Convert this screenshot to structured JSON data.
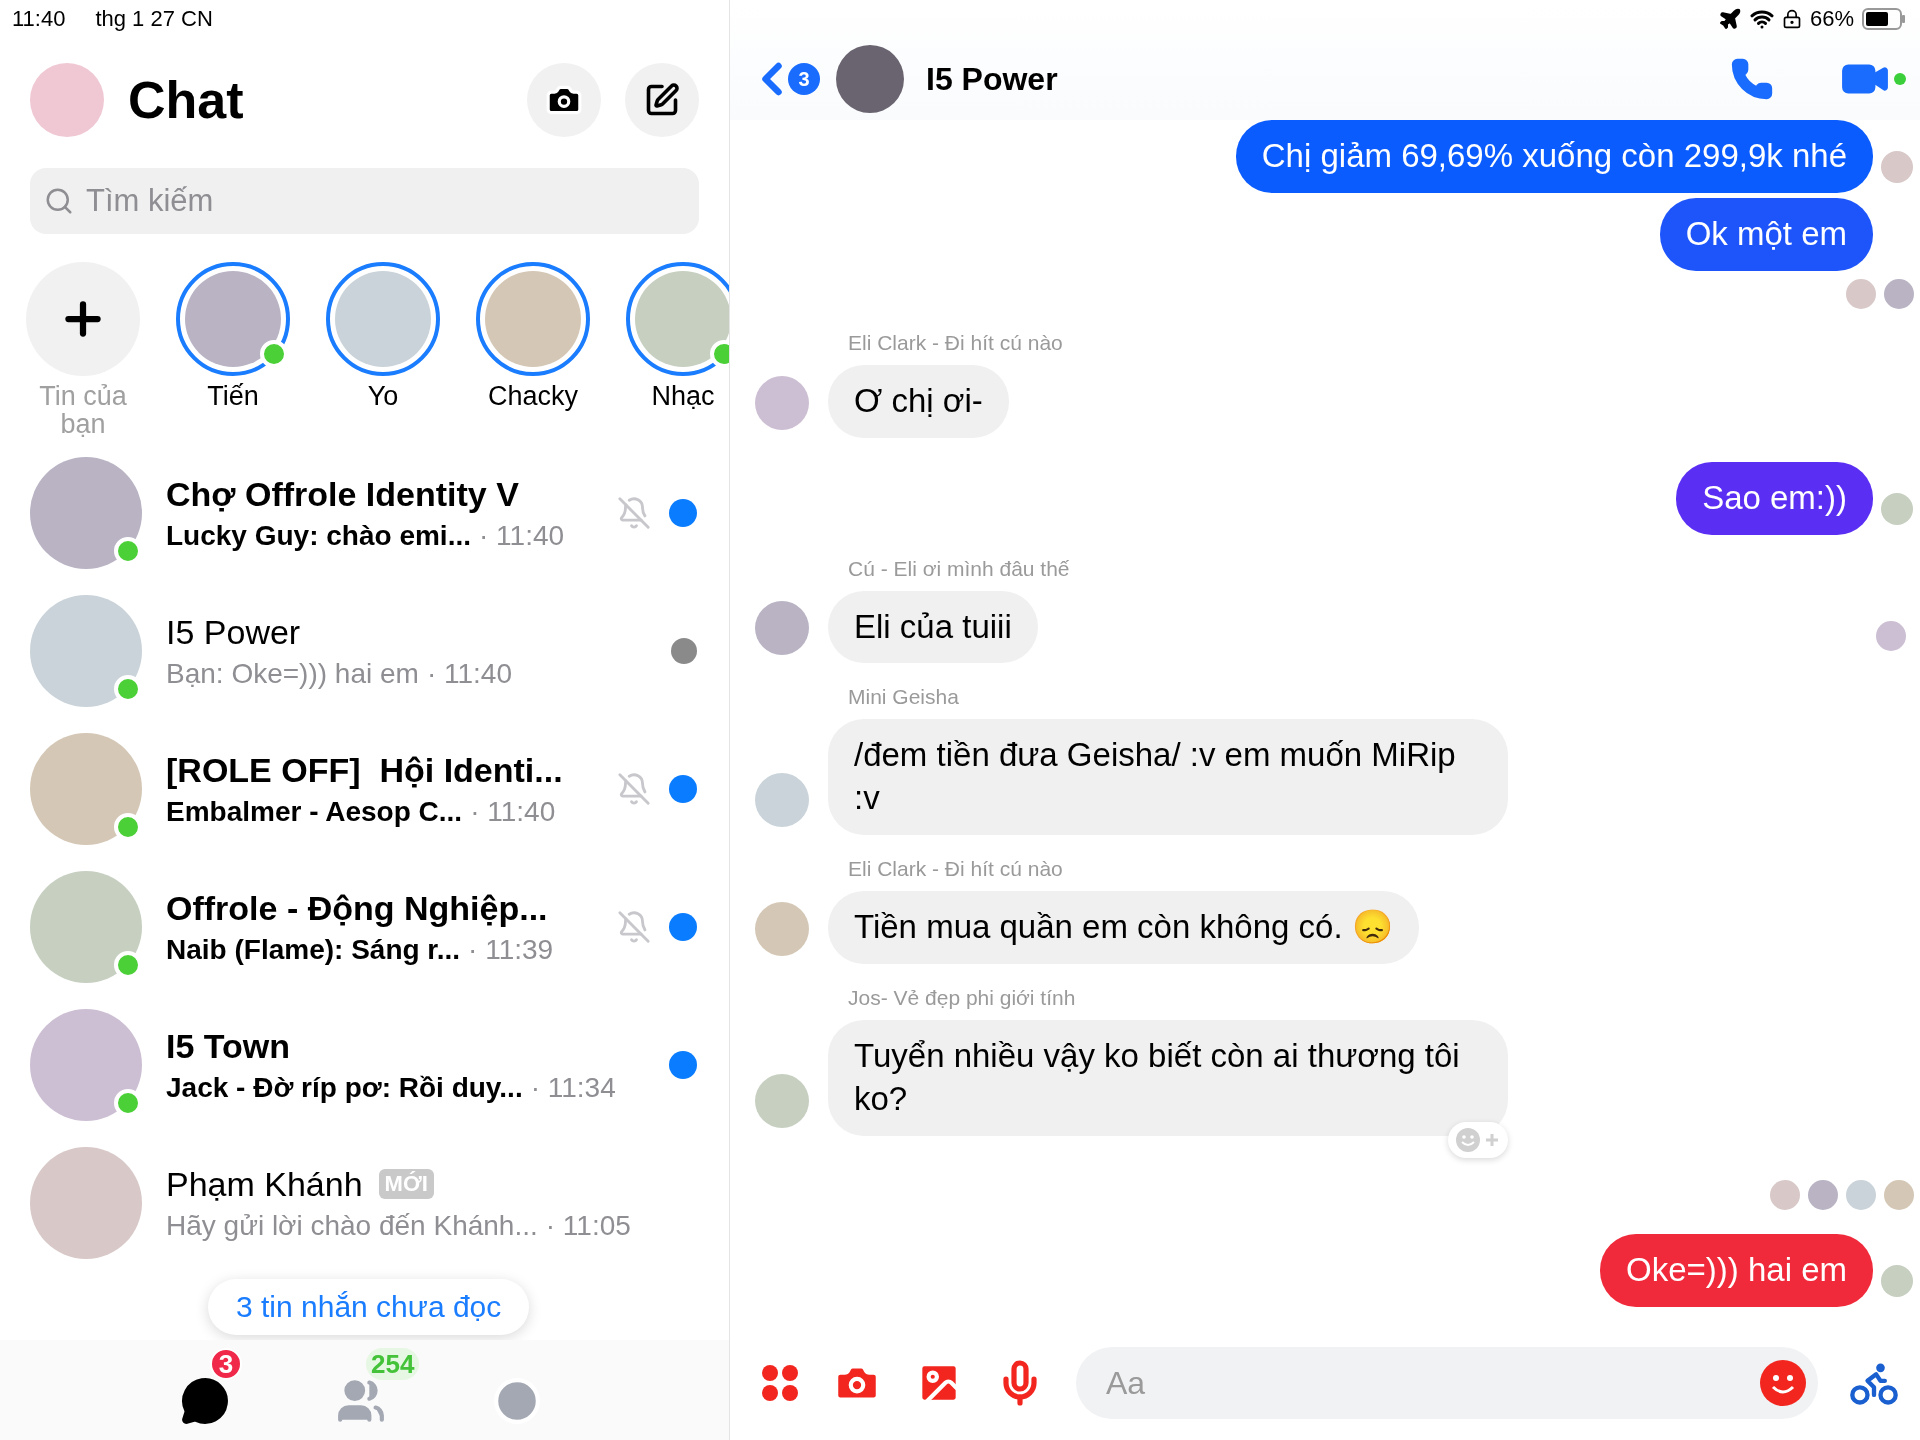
{
  "status_bar": {
    "time": "11:40",
    "date": "thg 1 27 CN",
    "battery_text": "66%"
  },
  "sidebar": {
    "title": "Chat",
    "search": {
      "placeholder": "Tìm kiếm"
    },
    "stories": [
      {
        "kind": "add",
        "label": "Tin của bạn",
        "online": false
      },
      {
        "kind": "story",
        "label": "Tiến",
        "online": true
      },
      {
        "kind": "story",
        "label": "Yo",
        "online": false
      },
      {
        "kind": "story",
        "label": "Chacky",
        "online": false
      },
      {
        "kind": "story",
        "label": "Nhạc",
        "online": true
      }
    ],
    "chats": [
      {
        "name": "Chợ Offrole Identity V",
        "preview": "Lucky Guy: chào emi...",
        "time": "· 11:40",
        "unread": true,
        "muted": true,
        "online": true,
        "seen": false
      },
      {
        "name": "I5 Power",
        "preview": "Bạn: Oke=))) hai em",
        "time": "· 11:40",
        "unread": false,
        "muted": false,
        "online": true,
        "seen": true
      },
      {
        "name": "[ROLE OFF]  Hội Identi...",
        "preview": "Embalmer - Aesop C...",
        "time": "· 11:40",
        "unread": true,
        "muted": true,
        "online": true,
        "seen": false
      },
      {
        "name": "Offrole - Động Nghiệp...",
        "preview": "Naib (Flame): Sáng r...",
        "time": "· 11:39",
        "unread": true,
        "muted": true,
        "online": true,
        "seen": false
      },
      {
        "name": "I5 Town",
        "preview": "Jack - Đờ ríp pơ: Rồi duy...",
        "time": "· 11:34",
        "unread": true,
        "muted": false,
        "online": true,
        "seen": false
      },
      {
        "name": "Phạm Khánh",
        "badge": "MỚI",
        "preview": "Hãy gửi lời chào đến Khánh...",
        "time": "· 11:05",
        "unread": false,
        "muted": false,
        "online": false,
        "seen": false
      }
    ],
    "unread_pill": "3 tin nhắn chưa đọc",
    "tabs": [
      {
        "kind": "chats",
        "badge": "3",
        "selected": true
      },
      {
        "kind": "people",
        "badge": "254",
        "selected": false
      },
      {
        "kind": "discover",
        "selected": false
      }
    ]
  },
  "conversation": {
    "back_badge": "3",
    "title": "I5 Power",
    "active": true,
    "messages": [
      {
        "kind": "outgoing",
        "text": "Chị giảm 69,69% xuống còn 299,9k nhé",
        "color": "#0b5cff",
        "read_avatar": true
      },
      {
        "kind": "outgoing",
        "text": "Ok một em",
        "color": "#1d55fb",
        "read_avatar": false
      },
      {
        "kind": "receipts",
        "readers": [
          {
            "kind": "avatar"
          },
          {
            "kind": "avatar"
          }
        ]
      },
      {
        "kind": "incoming",
        "sender": "Eli Clark - Đi hít cú nào",
        "text": "Ơ chị ơi-",
        "reader": false,
        "react_button": false
      },
      {
        "kind": "outgoing",
        "text": "Sao em:))",
        "color": "#5b2ef4",
        "read_avatar": true
      },
      {
        "kind": "incoming",
        "sender": "Cú - Eli ơi mình đâu thế",
        "text": "Eli của tuiii",
        "reader": true,
        "react_button": false
      },
      {
        "kind": "incoming",
        "sender": "Mini Geisha",
        "text": "/đem tiền đưa Geisha/ :v em muốn MiRip :v",
        "reader": false,
        "react_button": false
      },
      {
        "kind": "incoming",
        "sender": "Eli Clark - Đi hít cú nào",
        "text": "Tiền mua quần em còn không có. 😞",
        "reader": false,
        "react_button": false
      },
      {
        "kind": "incoming",
        "sender": "Jos- Vẻ đẹp phi giới tính",
        "text": "Tuyển nhiều vậy ko biết còn ai thương tôi ko?",
        "reader": false,
        "react_button": true
      },
      {
        "kind": "receipts",
        "readers": [
          {
            "kind": "avatar"
          },
          {
            "kind": "avatar"
          },
          {
            "kind": "avatar"
          },
          {
            "kind": "avatar"
          }
        ]
      },
      {
        "kind": "outgoing",
        "text": "Oke=))) hai em",
        "color": "#f02a3b",
        "read_avatar": true
      }
    ],
    "composer": {
      "placeholder": "Aa"
    }
  }
}
